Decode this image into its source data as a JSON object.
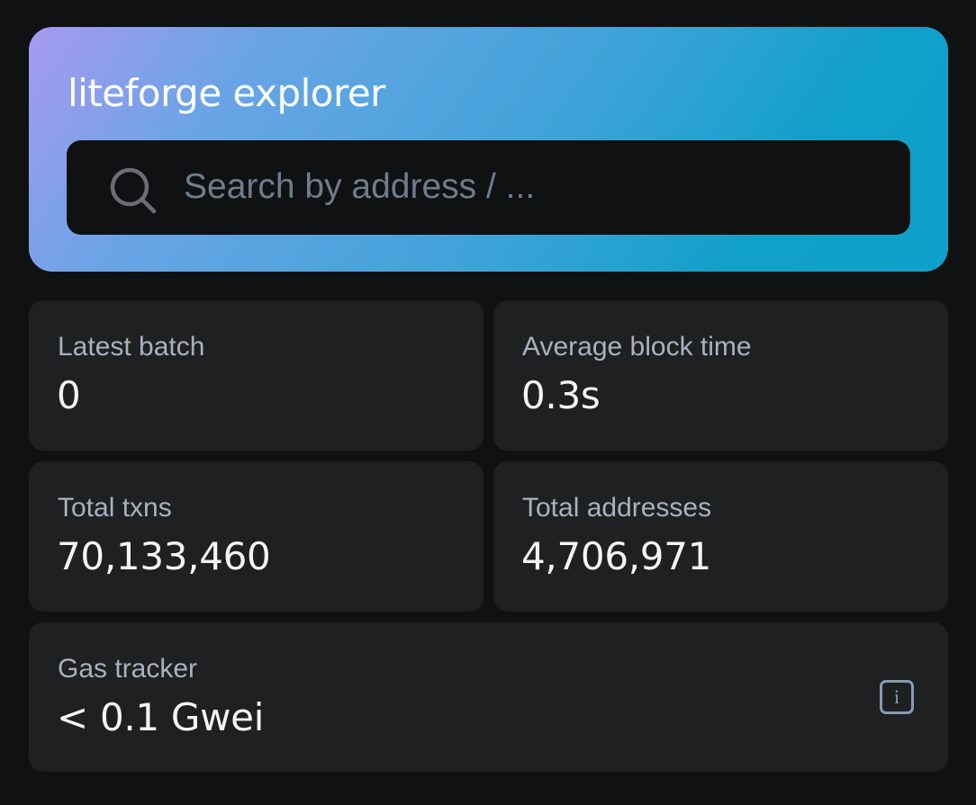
{
  "header": {
    "title": "liteforge explorer"
  },
  "search": {
    "placeholder": "Search by address / ...",
    "value": "",
    "icon": "search-icon"
  },
  "stats": {
    "latest_batch": {
      "label": "Latest batch",
      "value": "0"
    },
    "average_block_time": {
      "label": "Average block time",
      "value": "0.3s"
    },
    "total_txns": {
      "label": "Total txns",
      "value": "70,133,460"
    },
    "total_addresses": {
      "label": "Total addresses",
      "value": "4,706,971"
    },
    "gas_tracker": {
      "label": "Gas tracker",
      "value": "< 0.1 Gwei",
      "info_icon": "info-icon",
      "info_glyph": "i"
    }
  },
  "colors": {
    "background": "#101112",
    "card": "#1f2022",
    "hero_gradient_start": "#a79af0",
    "hero_gradient_end": "#0ea0c8",
    "label_text": "#a9b2bd",
    "value_text": "#f3f4f5",
    "placeholder_text": "#6f7c8d"
  }
}
